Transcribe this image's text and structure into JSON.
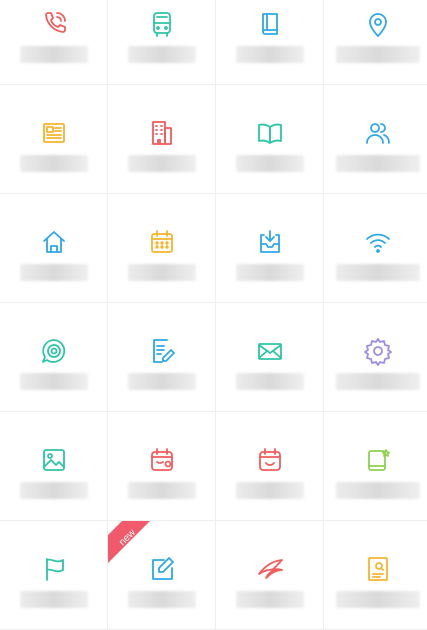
{
  "grid": {
    "items": [
      {
        "icon": "phone-call-icon",
        "color": "#f25c5c",
        "label": ""
      },
      {
        "icon": "bus-icon",
        "color": "#2ec4a6",
        "label": ""
      },
      {
        "icon": "book-icon",
        "color": "#2ea8e6",
        "label": ""
      },
      {
        "icon": "location-pin-icon",
        "color": "#2ea8e6",
        "label": ""
      },
      {
        "icon": "newspaper-icon",
        "color": "#f5b52e",
        "label": ""
      },
      {
        "icon": "building-icon",
        "color": "#f25c5c",
        "label": ""
      },
      {
        "icon": "open-book-icon",
        "color": "#2ec4a6",
        "label": ""
      },
      {
        "icon": "users-icon",
        "color": "#2ea8e6",
        "label": ""
      },
      {
        "icon": "home-icon",
        "color": "#2ea8e6",
        "label": ""
      },
      {
        "icon": "calendar-icon",
        "color": "#f5b52e",
        "label": ""
      },
      {
        "icon": "inbox-download-icon",
        "color": "#2ea8e6",
        "label": ""
      },
      {
        "icon": "wifi-icon",
        "color": "#2ea8e6",
        "label": ""
      },
      {
        "icon": "chat-target-icon",
        "color": "#2ec4a6",
        "label": ""
      },
      {
        "icon": "note-edit-icon",
        "color": "#2ea8e6",
        "label": ""
      },
      {
        "icon": "mail-icon",
        "color": "#2ec4a6",
        "label": ""
      },
      {
        "icon": "settings-gear-icon",
        "color": "#9a8ee6",
        "label": ""
      },
      {
        "icon": "image-icon",
        "color": "#2ec4a6",
        "label": ""
      },
      {
        "icon": "calendar-check-icon",
        "color": "#f25c5c",
        "label": ""
      },
      {
        "icon": "calendar-smile-icon",
        "color": "#f25c5c",
        "label": ""
      },
      {
        "icon": "tablet-star-icon",
        "color": "#8ed14f",
        "label": ""
      },
      {
        "icon": "flag-icon",
        "color": "#2ec4a6",
        "label": ""
      },
      {
        "icon": "edit-pencil-icon",
        "color": "#2ea8e6",
        "label": "",
        "badge": "new"
      },
      {
        "icon": "airline-bird-icon",
        "color": "#f25c5c",
        "label": ""
      },
      {
        "icon": "document-search-icon",
        "color": "#f5b52e",
        "label": ""
      }
    ]
  },
  "badge_color": "#f05a6a"
}
